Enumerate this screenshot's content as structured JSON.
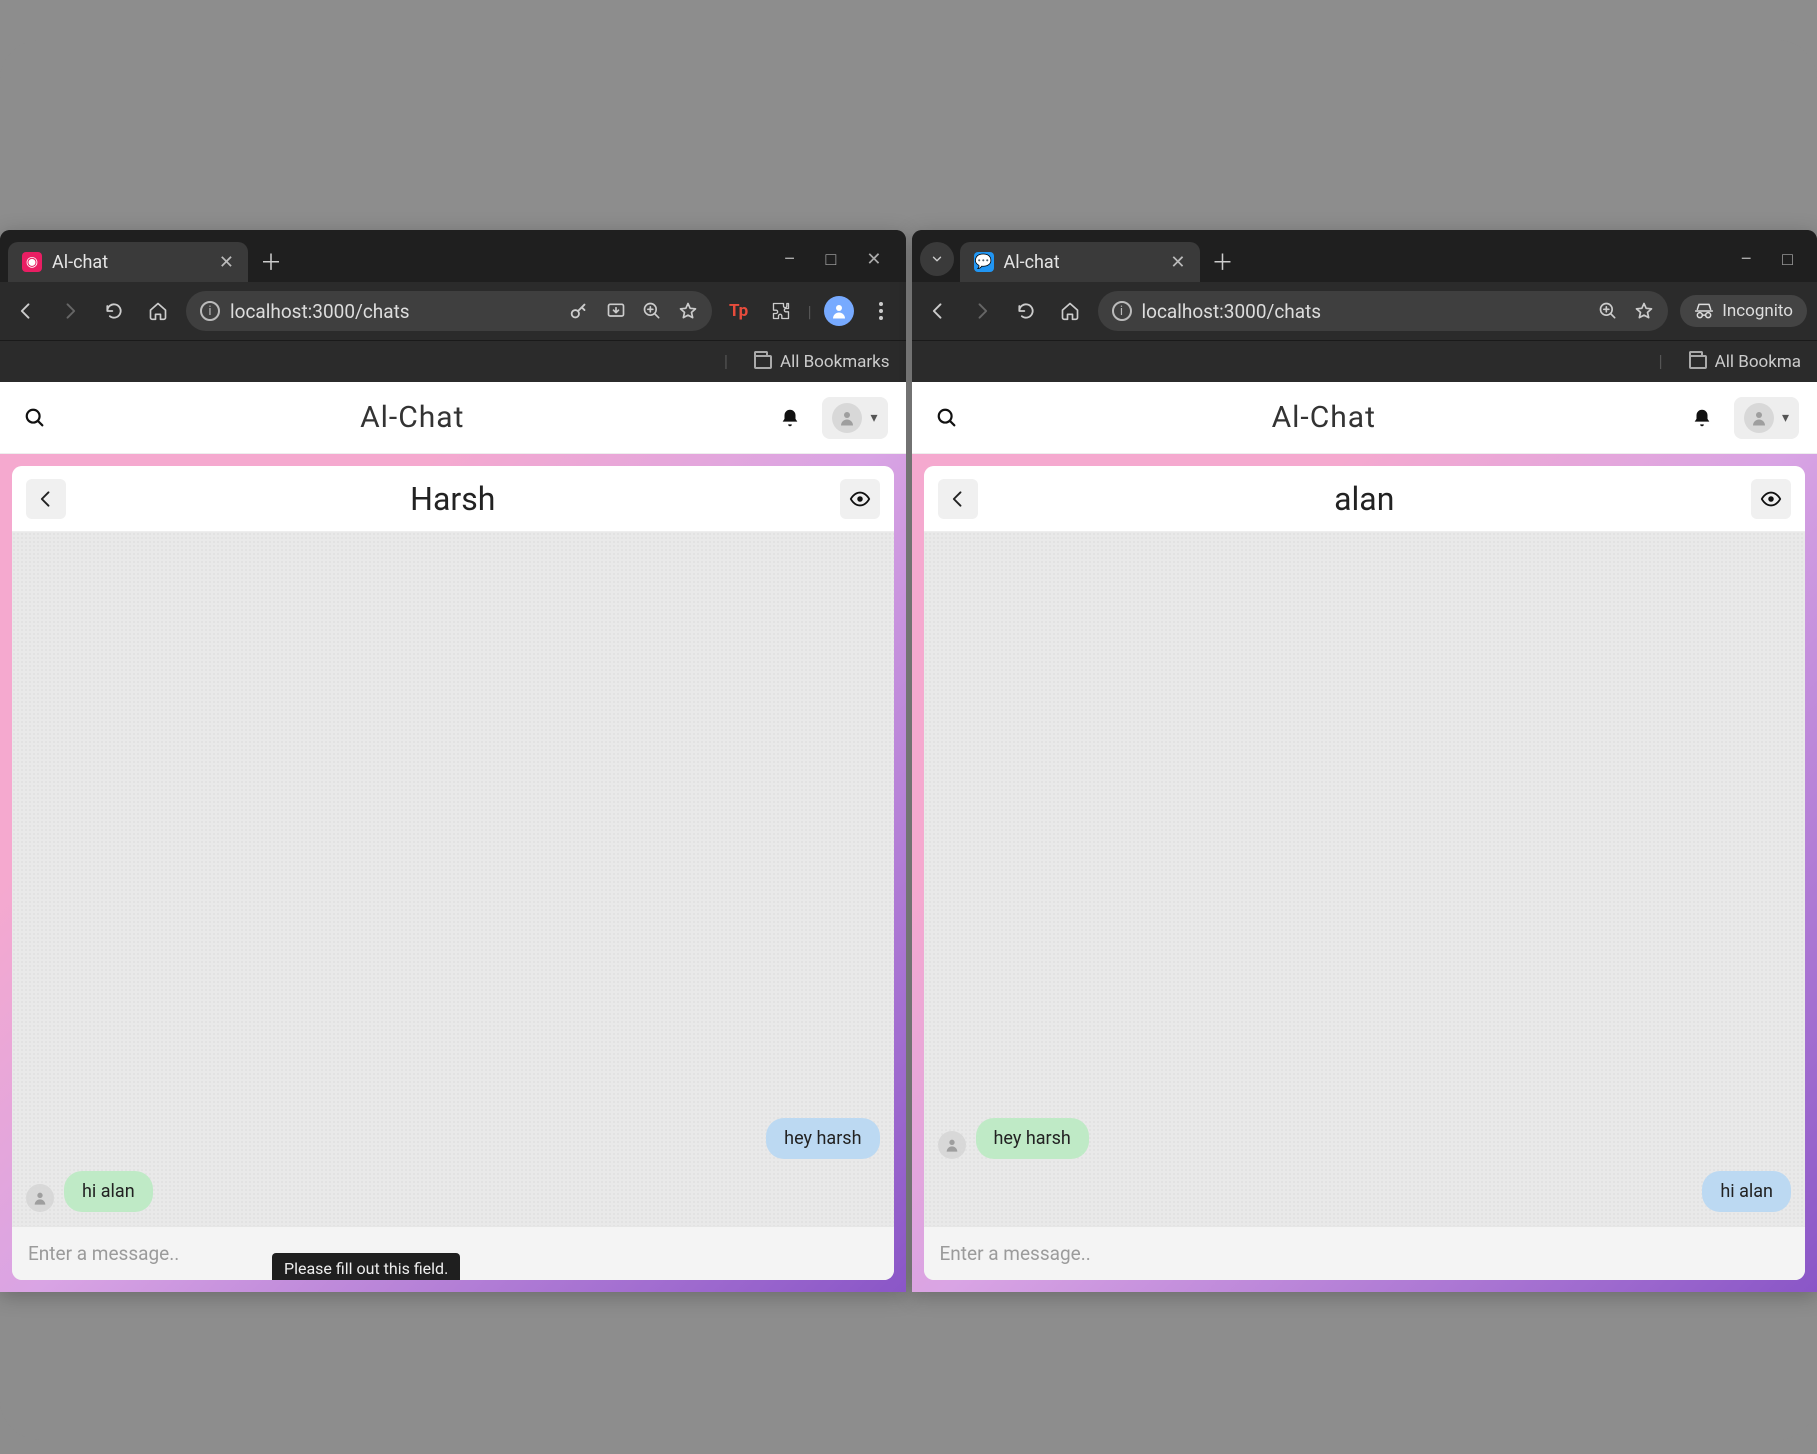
{
  "windows": [
    {
      "tab": {
        "title": "Al-chat",
        "favicon": "pink"
      },
      "url": "localhost:3000/chats",
      "window_controls": {
        "min": "–",
        "max": "□",
        "close": "✕"
      },
      "toolbar_icons": [
        "key",
        "install",
        "zoom",
        "star"
      ],
      "extensions": [
        "Tp",
        "puzzle"
      ],
      "bookmarks": {
        "label": "All Bookmarks"
      },
      "profile_type": "avatar",
      "app": {
        "title": "Al-Chat",
        "chat_name": "Harsh",
        "messages": [
          {
            "side": "right",
            "text": "hey harsh",
            "color": "blue"
          },
          {
            "side": "left",
            "text": "hi alan",
            "color": "green",
            "avatar": true
          }
        ],
        "input_placeholder": "Enter a message..",
        "tooltip": "Please fill out this field."
      }
    },
    {
      "tab": {
        "title": "Al-chat",
        "favicon": "chat",
        "has_dropdown": true
      },
      "url": "localhost:3000/chats",
      "window_controls": {
        "min": "–",
        "max": "□",
        "close": ""
      },
      "toolbar_icons": [
        "zoom",
        "star"
      ],
      "bookmarks": {
        "label": "All Bookma"
      },
      "profile_type": "incognito",
      "incognito_label": "Incognito",
      "app": {
        "title": "Al-Chat",
        "chat_name": "alan",
        "messages": [
          {
            "side": "left",
            "text": "hey harsh",
            "color": "green",
            "avatar": true
          },
          {
            "side": "right",
            "text": "hi alan",
            "color": "blue"
          }
        ],
        "input_placeholder": "Enter a message.."
      }
    }
  ]
}
